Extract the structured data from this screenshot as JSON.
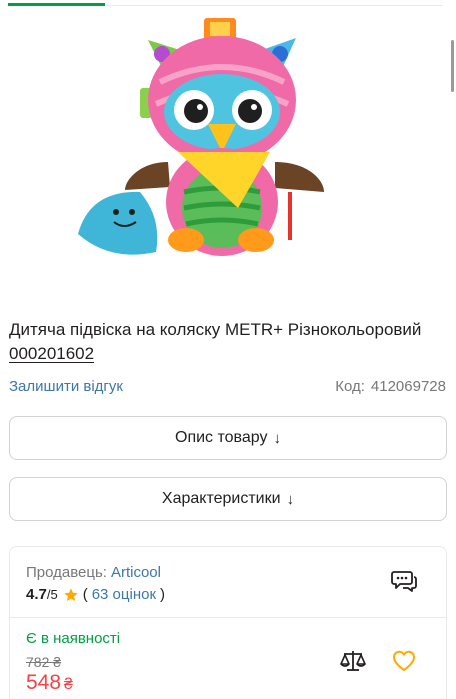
{
  "product": {
    "title_text": "Дитяча підвіска на коляску METR+ Різнокольоровий",
    "title_code": "000201602"
  },
  "review_link": "Залишити відгук",
  "product_code": {
    "label": "Код:",
    "value": "412069728"
  },
  "buttons": {
    "description": "Опис товару",
    "characteristics": "Характеристики",
    "arrow": "↓"
  },
  "seller": {
    "label": "Продавець:",
    "name": "Articool",
    "rating": "4.7",
    "rating_max": "/5",
    "ratings_count_text": "63 оцінок",
    "open_paren": "(",
    "close_paren": ")"
  },
  "offer": {
    "status": "Є в наявності",
    "old_price": "782 ₴",
    "new_price": "548",
    "currency": "₴"
  },
  "colors": {
    "accent_green": "#00a046",
    "link_blue": "#3e77aa",
    "price_red": "#f84147",
    "star_yellow": "#ffa900"
  },
  "icons": [
    "product-image",
    "star-icon",
    "chat-icon",
    "compare-icon",
    "heart-icon"
  ]
}
